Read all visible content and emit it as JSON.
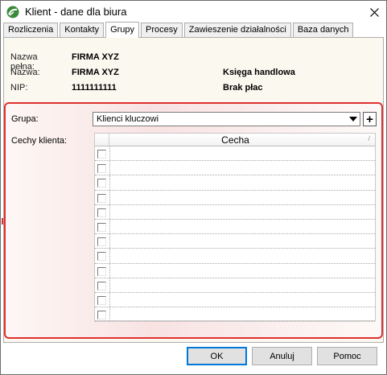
{
  "window": {
    "title": "Klient - dane dla biura",
    "close_glyph": "✕"
  },
  "tabs": [
    {
      "label": "Rozliczenia",
      "active": false
    },
    {
      "label": "Kontakty",
      "active": false
    },
    {
      "label": "Grupy",
      "active": true
    },
    {
      "label": "Procesy",
      "active": false
    },
    {
      "label": "Zawieszenie działalności",
      "active": false
    },
    {
      "label": "Baza danych",
      "active": false
    }
  ],
  "info": {
    "full_name_label": "Nazwa pełna:",
    "full_name_value": "FIRMA XYZ",
    "name_label": "Nazwa:",
    "name_value": "FIRMA XYZ",
    "ledger": "Księga handlowa",
    "nip_label": "NIP:",
    "nip_value": "1111111111",
    "payroll": "Brak płac"
  },
  "group": {
    "label": "Grupa:",
    "selected": "Klienci kluczowi",
    "add_glyph": "+"
  },
  "traits": {
    "label": "Cechy klienta:",
    "column_header": "Cecha",
    "sort_glyph": "/",
    "rows": [
      "",
      "",
      "",
      "",
      "",
      "",
      "",
      "",
      "",
      "",
      "",
      ""
    ]
  },
  "buttons": {
    "ok": "OK",
    "cancel": "Anuluj",
    "help": "Pomoc"
  },
  "icons": {
    "app": "app-logo-icon",
    "close": "close-icon",
    "dropdown": "chevron-down-icon",
    "add": "plus-icon"
  },
  "colors": {
    "highlight_border": "#e03030",
    "default_button_border": "#0078d7",
    "app_icon": "#3a8a3a"
  }
}
